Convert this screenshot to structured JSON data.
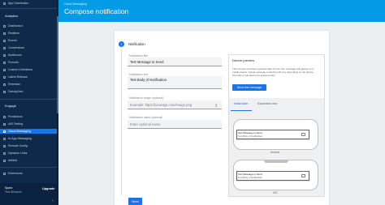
{
  "sidebar": {
    "top_item": "App Distribution",
    "analytics_header": "Analytics",
    "analytics_items": [
      "Dashboard",
      "Realtime",
      "Events",
      "Conversions",
      "Audiences",
      "Funnels",
      "Custom Definitions",
      "Latest Release",
      "Retention",
      "DebugView"
    ],
    "engage_header": "Engage",
    "engage_items": [
      "Predictions",
      "A/B Testing",
      "Cloud Messaging",
      "In-App Messaging",
      "Remote Config",
      "Dynamic Links",
      "AdMob"
    ],
    "extensions": "Extensions",
    "plan_name": "Spark",
    "plan_price": "Free $0/month",
    "upgrade": "Upgrade",
    "collapse_icon": "chevron-left-icon"
  },
  "header": {
    "breadcrumb": "Cloud Messaging",
    "page_title": "Compose notification"
  },
  "form": {
    "step_number": "1",
    "step_title": "Notification",
    "title_label": "Notification title",
    "title_value": "Test Message to Send",
    "text_label": "Notification text",
    "text_value": "Test Body of Notification",
    "image_label": "Notification image (optional)",
    "image_placeholder": "Example: https://yourapp.com/image.png",
    "name_label": "Notification name (optional)",
    "name_placeholder": "Enter optional name",
    "next": "Next"
  },
  "preview": {
    "title": "Device preview",
    "description": "This preview provides a general idea of how your message will appear on a mobile device. Actual message rendering will vary depending on the device. Test with a real device for actual results.",
    "send_button": "Send test message",
    "tabs": [
      "Initial state",
      "Expanded view"
    ],
    "notif_title": "Test Message to Send",
    "notif_body": "Test Body of Notification",
    "android_caption": "Android",
    "ios_caption": "iOS"
  },
  "colors": {
    "header": "#039be5",
    "sidebar": "#0d2a4a",
    "accent": "#1a73e8"
  }
}
